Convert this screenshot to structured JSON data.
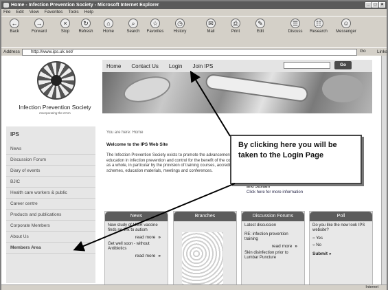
{
  "window": {
    "title": "Home - Infection Prevention Society - Microsoft Internet Explorer",
    "controls": [
      "_",
      "□",
      "×"
    ]
  },
  "menu": [
    "File",
    "Edit",
    "View",
    "Favorites",
    "Tools",
    "Help"
  ],
  "toolbar": [
    {
      "label": "Back",
      "icon": "back-icon",
      "glyph": "←"
    },
    {
      "label": "Forward",
      "icon": "forward-icon",
      "glyph": "→"
    },
    {
      "label": "Stop",
      "icon": "stop-icon",
      "glyph": "×"
    },
    {
      "label": "Refresh",
      "icon": "refresh-icon",
      "glyph": "↻"
    },
    {
      "label": "Home",
      "icon": "home-icon",
      "glyph": "⌂"
    },
    {
      "label": "Search",
      "icon": "search-icon",
      "glyph": "⌕"
    },
    {
      "label": "Favorites",
      "icon": "favorites-icon",
      "glyph": "☆"
    },
    {
      "label": "History",
      "icon": "history-icon",
      "glyph": "◷"
    },
    {
      "label": "Mail",
      "icon": "mail-icon",
      "glyph": "✉"
    },
    {
      "label": "Print",
      "icon": "print-icon",
      "glyph": "⎙"
    },
    {
      "label": "Edit",
      "icon": "edit-icon",
      "glyph": "✎"
    },
    {
      "label": "Discuss",
      "icon": "discuss-icon",
      "glyph": "☰"
    },
    {
      "label": "Research",
      "icon": "research-icon",
      "glyph": "☷"
    },
    {
      "label": "Messenger",
      "icon": "messenger-icon",
      "glyph": "☺"
    }
  ],
  "address": {
    "label": "Address",
    "url": "http://www.ips.uk.net/",
    "go": "Go",
    "links": "Links"
  },
  "org": {
    "name": "Infection Prevention Society",
    "sub": "Incorporating the ICNA"
  },
  "nav": {
    "items": [
      "Home",
      "Contact Us",
      "Login",
      "Join IPS"
    ],
    "go": "Go"
  },
  "sidebar": {
    "head": "IPS",
    "items": [
      "News",
      "Discussion Forum",
      "Diary of events",
      "BJIC",
      "Health care workers & public",
      "Career centre",
      "Products and publications",
      "Corporate Members",
      "About Us",
      "Members Area"
    ]
  },
  "content": {
    "breadcrumb": "You are here: Home",
    "welcome": "Welcome to the IPS Web Site",
    "intro": "The Infection Prevention Society exists to promote the advancement of education in infection prevention and control for the benefit of the community as a whole, in particular by the provision of training courses, accreditation schemes, education materials, meetings and conferences.",
    "partial": "and Sustain",
    "more_prefix": "Click ",
    "more_link": "here",
    "more_suffix": " for more information"
  },
  "callout": "By clicking here you will be taken to the Login Page",
  "boxes": {
    "news": {
      "title": "News",
      "items": [
        "New study of MMR vaccine finds no link to autism",
        "Get well soon - without Antibiotics"
      ],
      "read_more": "read more",
      "read_more_2": "read more"
    },
    "branches": {
      "title": "Branches"
    },
    "forums": {
      "title": "Discussion Forums",
      "items": [
        "Latest discussion",
        "RE: infection prevention training",
        "Skin disinfection prior to Lumbar Puncture"
      ],
      "read_more": "read more"
    },
    "poll": {
      "title": "Poll",
      "question": "Do you like the new look IPS website?",
      "options": [
        "Yes",
        "No"
      ],
      "submit": "Submit"
    }
  },
  "status": {
    "zone": "Internet"
  }
}
